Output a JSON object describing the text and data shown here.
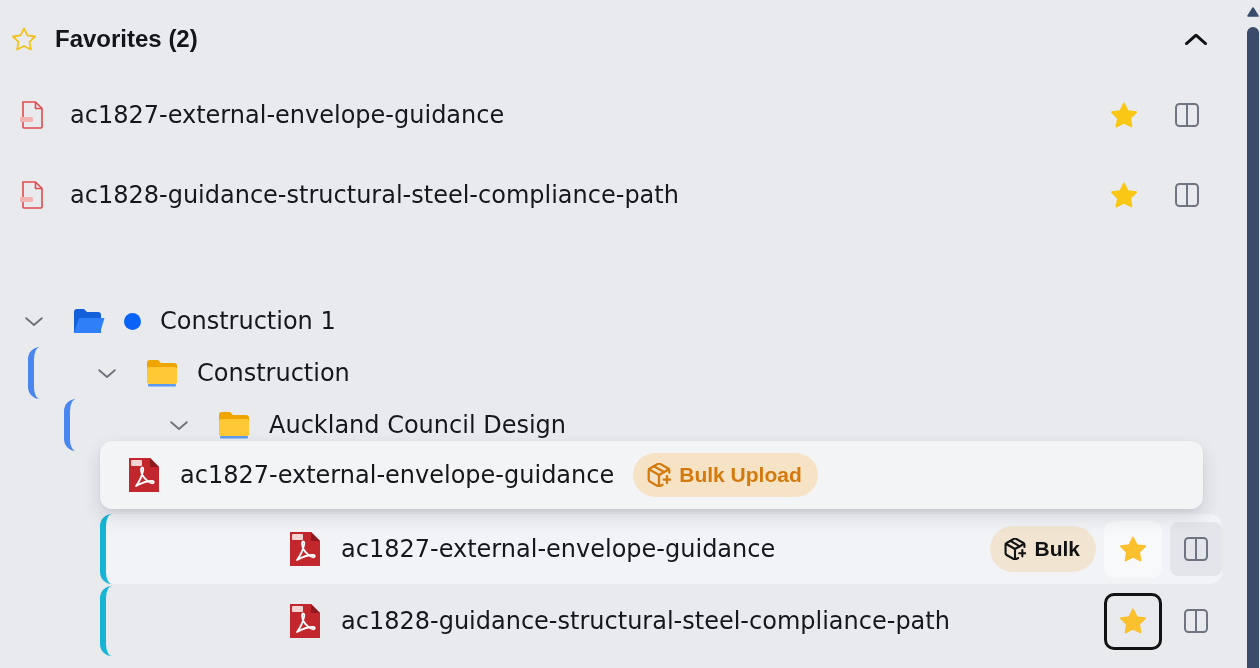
{
  "favorites": {
    "title": "Favorites (2)",
    "expanded": true,
    "items": [
      {
        "name": "ac1827-external-envelope-guidance",
        "starred": true
      },
      {
        "name": "ac1828-guidance-structural-steel-compliance-path",
        "starred": true
      }
    ]
  },
  "tree": [
    {
      "kind": "workspace",
      "name": "Construction 1",
      "expanded": true,
      "color": "#0b63f6",
      "children": [
        {
          "kind": "folder",
          "name": "Construction",
          "expanded": true,
          "children": [
            {
              "kind": "folder",
              "name": "Auckland Council Design",
              "expanded": true,
              "children": [
                {
                  "kind": "file",
                  "name": "ac1827-external-envelope-guidance",
                  "selected": true,
                  "starred": true,
                  "star_focused": false,
                  "badge": "Bulk"
                },
                {
                  "kind": "file",
                  "name": "ac1828-guidance-structural-steel-compliance-path",
                  "selected": false,
                  "starred": true,
                  "star_focused": true
                }
              ]
            }
          ]
        }
      ]
    }
  ],
  "drag_preview": {
    "name": "ac1827-external-envelope-guidance",
    "badge": "Bulk Upload"
  }
}
